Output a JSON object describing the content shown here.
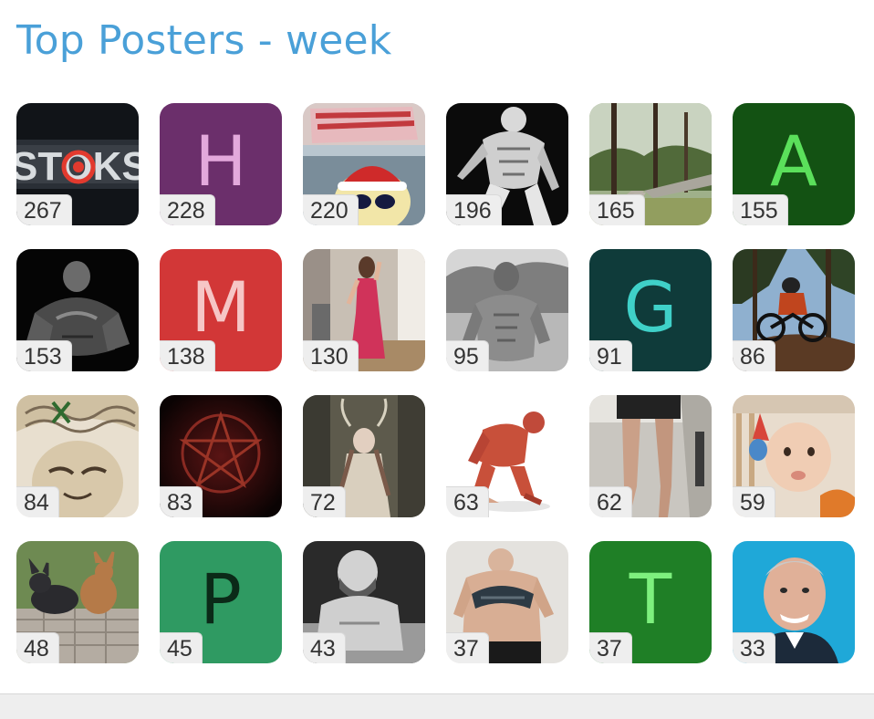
{
  "header": {
    "title": "Top Posters - week"
  },
  "posters": [
    {
      "count": "267",
      "kind": "photo",
      "avatar": "stoks-logo"
    },
    {
      "count": "228",
      "kind": "letter",
      "letter": "H",
      "bg": "#6b2f6b",
      "fg": "#e3a9dc"
    },
    {
      "count": "220",
      "kind": "photo",
      "avatar": "cartoon-respect-authority"
    },
    {
      "count": "196",
      "kind": "photo",
      "avatar": "bw-bodybuilder"
    },
    {
      "count": "165",
      "kind": "photo",
      "avatar": "forest-path"
    },
    {
      "count": "155",
      "kind": "letter",
      "letter": "A",
      "bg": "#135213",
      "fg": "#5be05b"
    },
    {
      "count": "153",
      "kind": "photo",
      "avatar": "dark-bodybuilder"
    },
    {
      "count": "138",
      "kind": "letter",
      "letter": "M",
      "bg": "#d23737",
      "fg": "#f6c6c6"
    },
    {
      "count": "130",
      "kind": "photo",
      "avatar": "woman-pink-dress"
    },
    {
      "count": "95",
      "kind": "photo",
      "avatar": "shirtless-man"
    },
    {
      "count": "91",
      "kind": "letter",
      "letter": "G",
      "bg": "#0f3b3a",
      "fg": "#3fd0c8"
    },
    {
      "count": "86",
      "kind": "photo",
      "avatar": "mountain-biker"
    },
    {
      "count": "84",
      "kind": "photo",
      "avatar": "brain-illustration"
    },
    {
      "count": "83",
      "kind": "photo",
      "avatar": "pentagram"
    },
    {
      "count": "72",
      "kind": "photo",
      "avatar": "horned-figure"
    },
    {
      "count": "63",
      "kind": "photo",
      "avatar": "anatomy-figure"
    },
    {
      "count": "62",
      "kind": "photo",
      "avatar": "legs"
    },
    {
      "count": "59",
      "kind": "photo",
      "avatar": "baby"
    },
    {
      "count": "48",
      "kind": "photo",
      "avatar": "dogs"
    },
    {
      "count": "45",
      "kind": "letter",
      "letter": "P",
      "bg": "#2f9a62",
      "fg": "#0b2a18"
    },
    {
      "count": "43",
      "kind": "photo",
      "avatar": "bald-man-bw"
    },
    {
      "count": "37",
      "kind": "photo",
      "avatar": "back-tattoo"
    },
    {
      "count": "37",
      "kind": "letter",
      "letter": "T",
      "bg": "#1f7f26",
      "fg": "#7ef07e"
    },
    {
      "count": "33",
      "kind": "photo",
      "avatar": "man-blue-background"
    }
  ]
}
